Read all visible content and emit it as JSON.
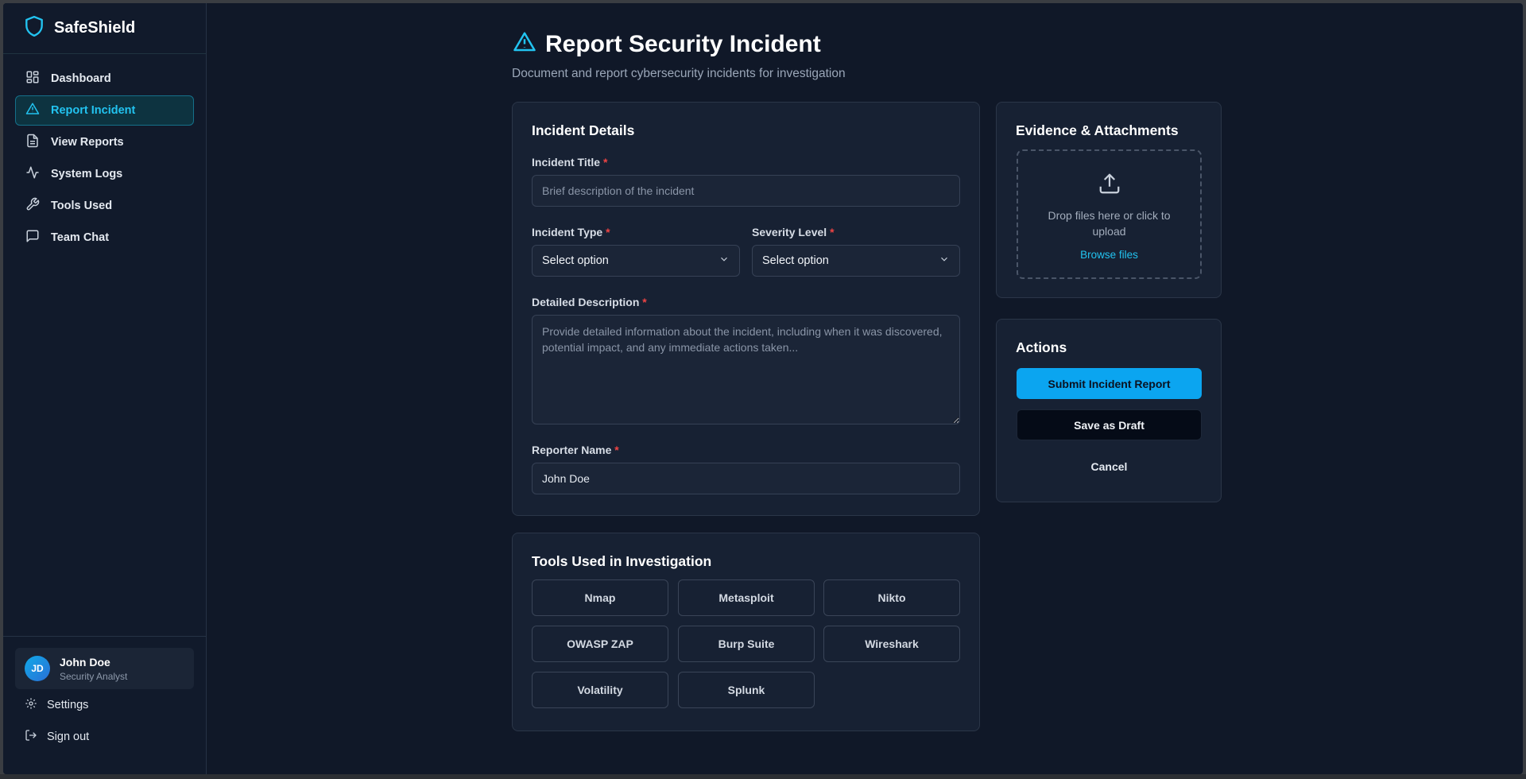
{
  "app": {
    "name": "SafeShield",
    "colors": {
      "accent": "#22c3f0",
      "primary_button": "#0ba5f0",
      "background": "#101828",
      "required": "#ef4444"
    }
  },
  "sidebar": {
    "items": [
      {
        "label": "Dashboard",
        "icon": "dashboard-icon",
        "active": false
      },
      {
        "label": "Report Incident",
        "icon": "alert-triangle-icon",
        "active": true
      },
      {
        "label": "View Reports",
        "icon": "file-text-icon",
        "active": false
      },
      {
        "label": "System Logs",
        "icon": "activity-icon",
        "active": false
      },
      {
        "label": "Tools Used",
        "icon": "wrench-icon",
        "active": false
      },
      {
        "label": "Team Chat",
        "icon": "message-square-icon",
        "active": false
      }
    ],
    "user": {
      "initials": "JD",
      "name": "John Doe",
      "role": "Security Analyst"
    },
    "settings_label": "Settings",
    "signout_label": "Sign out"
  },
  "page": {
    "title": "Report Security Incident",
    "subtitle": "Document and report cybersecurity incidents for investigation"
  },
  "incident_details": {
    "heading": "Incident Details",
    "title_label": "Incident Title",
    "title_placeholder": "Brief description of the incident",
    "type_label": "Incident Type",
    "type_value": "Select option",
    "severity_label": "Severity Level",
    "severity_value": "Select option",
    "description_label": "Detailed Description",
    "description_placeholder": "Provide detailed information about the incident, including when it was discovered, potential impact, and any immediate actions taken...",
    "reporter_label": "Reporter Name",
    "reporter_value": "John Doe",
    "required_mark": "*"
  },
  "tools": {
    "heading": "Tools Used in Investigation",
    "items": [
      "Nmap",
      "Metasploit",
      "Nikto",
      "OWASP ZAP",
      "Burp Suite",
      "Wireshark",
      "Volatility",
      "Splunk"
    ]
  },
  "evidence": {
    "heading": "Evidence & Attachments",
    "drop_text": "Drop files here or click to upload",
    "browse_label": "Browse files"
  },
  "actions": {
    "heading": "Actions",
    "submit_label": "Submit Incident Report",
    "draft_label": "Save as Draft",
    "cancel_label": "Cancel"
  }
}
